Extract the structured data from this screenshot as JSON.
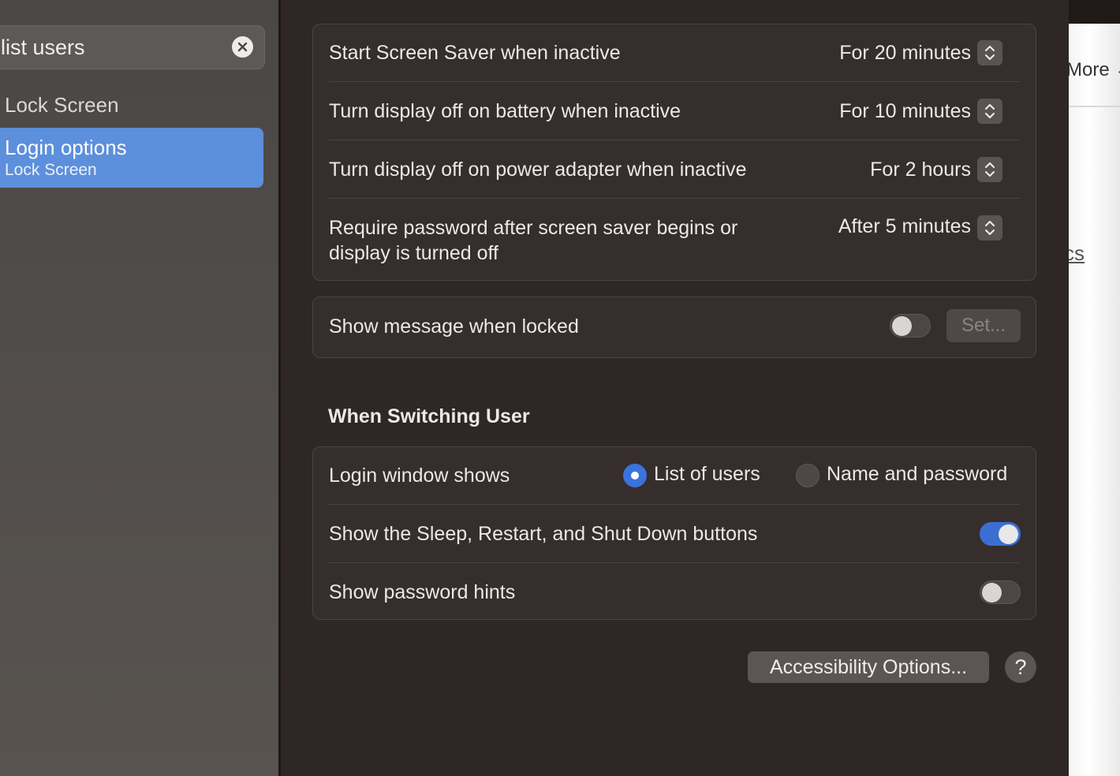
{
  "sidebar": {
    "search": {
      "value": "list users"
    },
    "items": [
      {
        "label": "Lock Screen"
      }
    ],
    "selected": {
      "label": "Login options",
      "sublabel": "Lock Screen"
    }
  },
  "lock_settings": {
    "rows": [
      {
        "label": "Start Screen Saver when inactive",
        "value": "For 20 minutes"
      },
      {
        "label": "Turn display off on battery when inactive",
        "value": "For 10 minutes"
      },
      {
        "label": "Turn display off on power adapter when inactive",
        "value": "For 2 hours"
      },
      {
        "label_line1": "Require password after screen saver begins or",
        "label_line2": "display is turned off",
        "value": "After 5 minutes"
      }
    ]
  },
  "message": {
    "label": "Show message when locked",
    "toggle_on": false,
    "set_button": "Set..."
  },
  "switching": {
    "title": "When Switching User",
    "login_window": {
      "label": "Login window shows",
      "options": [
        "List of users",
        "Name and password"
      ],
      "selected": "List of users"
    },
    "sleep_restart": {
      "label": "Show the Sleep, Restart, and Shut Down buttons",
      "toggle_on": true
    },
    "password_hints": {
      "label": "Show password hints",
      "toggle_on": false
    }
  },
  "footer": {
    "accessibility_button": "Accessibility Options...",
    "help_button": "?"
  },
  "background_window": {
    "more": "More",
    "link_fragment": "cs"
  },
  "colors": {
    "accent": "#3a73dc",
    "selection": "#5c8fdc",
    "panel": "#2e2726",
    "card": "#352e2d"
  }
}
